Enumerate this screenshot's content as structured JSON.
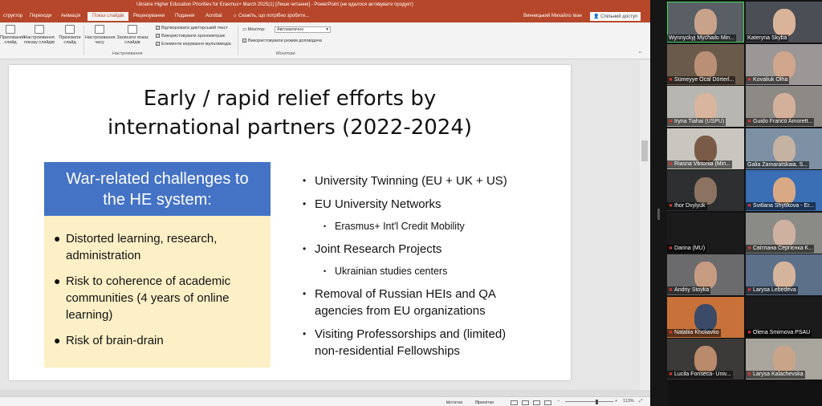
{
  "window": {
    "title": "Ukraine Higher Education Priorities for Erasmus+ March 2025(1) [Лише читання] - PowerPoint (не вдалося активувати продукт)",
    "user": "Винницький Михайло Іван",
    "share": "Спільний доступ",
    "accent": "#b7472a"
  },
  "ribbon": {
    "tabs": [
      {
        "label": "структор"
      },
      {
        "label": "Переходи"
      },
      {
        "label": "Анімація"
      },
      {
        "label": "Показ слайдів",
        "active": true
      },
      {
        "label": "Рецензування"
      },
      {
        "label": "Подання"
      },
      {
        "label": "Acrobat"
      },
      {
        "label": "Скажіть, що потрібно зробити..."
      }
    ],
    "buttons": [
      {
        "label": "Прихований слайд",
        "icon": "hide-slide-icon"
      },
      {
        "label": "Настроювання показу слайдів",
        "icon": "setup-show-icon"
      },
      {
        "label": "Приховати слайд",
        "icon": "hide-icon"
      },
      {
        "label": "Настроювання часу",
        "icon": "rehearse-timings-icon"
      },
      {
        "label": "Записати показ слайдів",
        "icon": "record-icon"
      }
    ],
    "checkboxes": [
      {
        "label": "Відтворювати дикторський текст",
        "checked": true
      },
      {
        "label": "Використовувати хронометраж",
        "checked": true
      },
      {
        "label": "Елементи керування мультимедіа",
        "checked": true
      }
    ],
    "monitor_label": "Монітор:",
    "monitor_value": "Автоматично",
    "presenter_view": "Використовувати режим доповідача",
    "presenter_checked": true,
    "group_setup": "Настроювання",
    "group_monitors": "Монітори"
  },
  "slide": {
    "title_line1": "Early / rapid relief efforts by",
    "title_line2": "international partners (2022-2024)",
    "box_heading_line1": "War-related challenges to",
    "box_heading_line2": "the HE system:",
    "box_color": "#4472c4",
    "box_body_color": "#fdf0c7",
    "left_bullets": [
      "Distorted learning, research, administration",
      "Risk to coherence of academic communities (4 years of online learning)",
      "Risk of brain-drain"
    ],
    "right_bullets": [
      {
        "text": "University Twinning (EU + UK + US)"
      },
      {
        "text": "EU University Networks",
        "sub": "Erasmus+ Int'l Credit Mobility"
      },
      {
        "text": "Joint Research Projects",
        "sub": "Ukrainian studies centers"
      },
      {
        "text": "Removal of Russian HEIs and QA agencies from EU organizations"
      },
      {
        "text": "Visiting Professorships and (limited) non-residential Fellowships"
      }
    ]
  },
  "status": {
    "notes": "Нотатки",
    "comments": "Примітки",
    "zoom": "113%"
  },
  "participants": [
    {
      "name": "Wynnyckyj Mychailo Min...",
      "mic_muted": false,
      "speaking": true,
      "bg": "#5a5f66",
      "face": "#c8a28a"
    },
    {
      "name": "Kateryna Skyba",
      "mic_muted": false,
      "bg": "#4b4f55",
      "face": "#d9b49a"
    },
    {
      "name": "Sümeyye Öcal Dörterl...",
      "mic_muted": true,
      "bg": "#6a5a4c",
      "face": "#b98f75"
    },
    {
      "name": "Kovaliuk Olha",
      "mic_muted": true,
      "bg": "#9a9796",
      "face": "#cfa68c"
    },
    {
      "name": "Iryna Tiahai (USPU)",
      "mic_muted": true,
      "bg": "#b8b6b0",
      "face": "#d8b59c"
    },
    {
      "name": "Guido Franco Amorett...",
      "mic_muted": true,
      "bg": "#8d8a86",
      "face": "#d2b09a"
    },
    {
      "name": "Riasna Viktoriia (Min...",
      "mic_muted": true,
      "bg": "#c9c6c0",
      "face": "#7a5b48"
    },
    {
      "name": "Galia Zamaratskaia, S...",
      "mic_muted": false,
      "bg": "#7e90a3",
      "face": "#c6b2a3"
    },
    {
      "name": "Ihor Dvylyuk",
      "mic_muted": true,
      "bg": "#2e2f31",
      "face": "#8c7361"
    },
    {
      "name": "Svitlana Shytikova - Er...",
      "mic_muted": true,
      "bg": "#3a6fb5",
      "face": "#d9a986"
    },
    {
      "name": "Darina (MU)",
      "mic_muted": true,
      "bg": "#1b1b1b",
      "face": "#1b1b1b"
    },
    {
      "name": "Світлана Сергієнка К...",
      "mic_muted": true,
      "bg": "#8a8a87",
      "face": "#ceb1a0"
    },
    {
      "name": "Andriy Stoyka",
      "mic_muted": true,
      "bg": "#6b6a6d",
      "face": "#c59c82"
    },
    {
      "name": "Larysa Lebedeva",
      "mic_muted": true,
      "bg": "#5d7089",
      "face": "#d4b59b"
    },
    {
      "name": "Nataliia Kholiavko",
      "mic_muted": true,
      "bg": "#c8723a",
      "face": "#3b4a66"
    },
    {
      "name": "Olena Smirnova PSAU",
      "mic_muted": true,
      "bg": "#1b1b1b",
      "face": "#1b1b1b"
    },
    {
      "name": "Lucila Fonseca- Univ...",
      "mic_muted": true,
      "bg": "#3c3a38",
      "face": "#b98a6c"
    },
    {
      "name": "Larysa Kalachevska",
      "mic_muted": true,
      "bg": "#a9a49c",
      "face": "#caa489"
    }
  ]
}
